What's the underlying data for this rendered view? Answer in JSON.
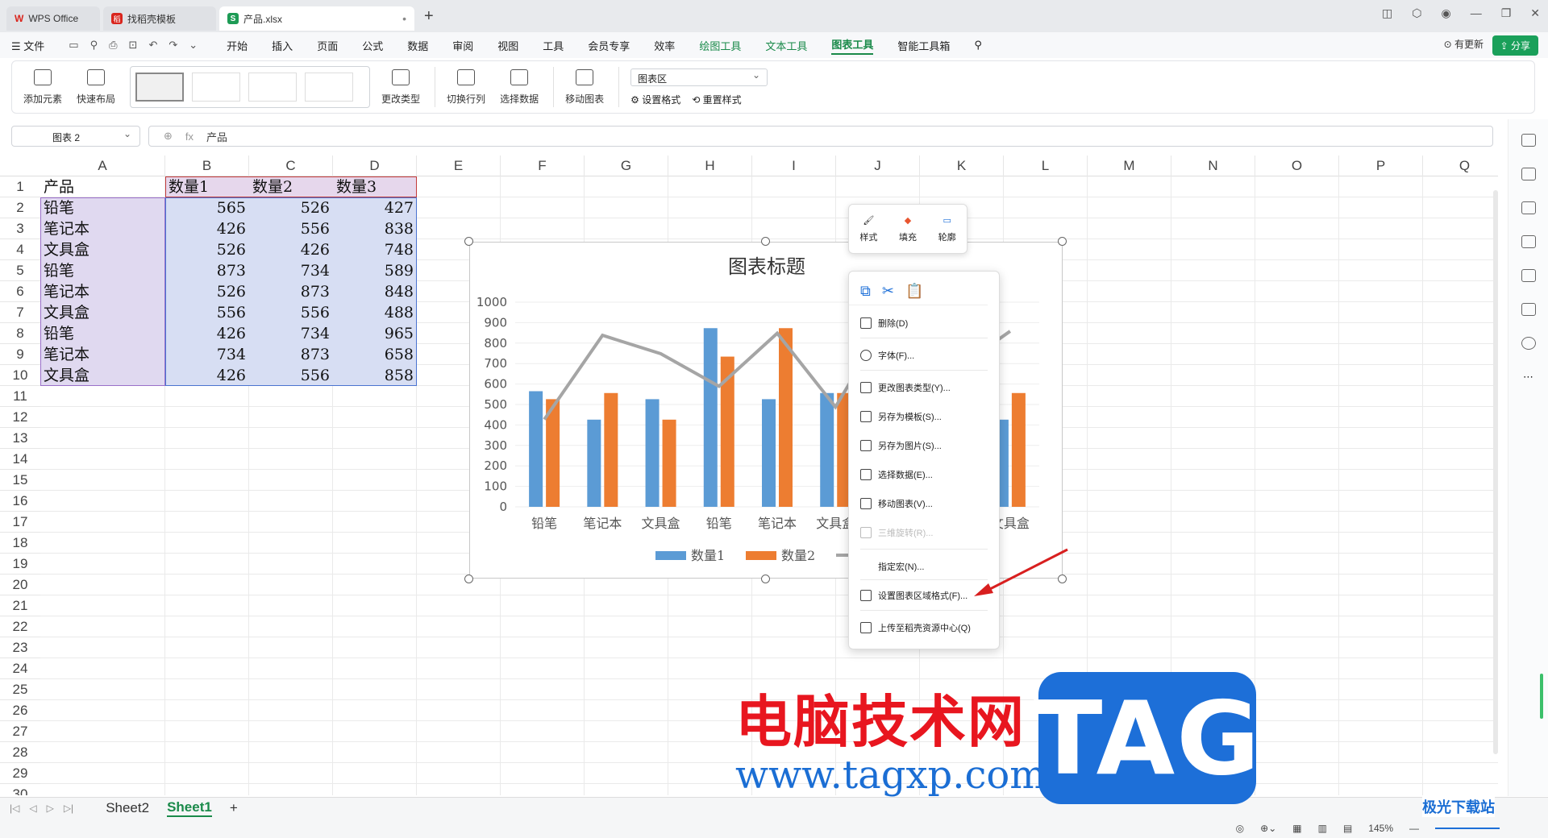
{
  "tabs": [
    {
      "label": "WPS Office"
    },
    {
      "label": "找稻壳模板"
    },
    {
      "label": "产品.xlsx"
    }
  ],
  "menu": {
    "file": "文件",
    "items": [
      "开始",
      "插入",
      "页面",
      "公式",
      "数据",
      "审阅",
      "视图",
      "工具",
      "会员专享",
      "效率",
      "绘图工具",
      "文本工具",
      "图表工具",
      "智能工具箱"
    ],
    "update": "有更新",
    "share": "分享"
  },
  "ribbon": {
    "add_element": "添加元素",
    "quick_layout": "快速布局",
    "change_type": "更改类型",
    "switch_rowcol": "切换行列",
    "select_data": "选择数据",
    "move_chart": "移动图表",
    "chart_area": "图表区",
    "set_format": "设置格式",
    "reset_style": "重置样式"
  },
  "formula": {
    "namebox": "图表 2",
    "fx": "fx",
    "value": "产品"
  },
  "columns": [
    "A",
    "B",
    "C",
    "D",
    "E",
    "F",
    "G",
    "H",
    "I",
    "J",
    "K",
    "L",
    "M",
    "N",
    "O",
    "P",
    "Q"
  ],
  "rows": [
    "1",
    "2",
    "3",
    "4",
    "5",
    "6",
    "7",
    "8",
    "9",
    "10",
    "11",
    "12",
    "13",
    "14",
    "15",
    "16",
    "17",
    "18",
    "19",
    "20",
    "21",
    "22",
    "23",
    "24",
    "25",
    "26",
    "27",
    "28",
    "29",
    "30"
  ],
  "table": {
    "header": [
      "产品",
      "数量1",
      "数量2",
      "数量3"
    ],
    "data": [
      [
        "铅笔",
        "565",
        "526",
        "427"
      ],
      [
        "笔记本",
        "426",
        "556",
        "838"
      ],
      [
        "文具盒",
        "526",
        "426",
        "748"
      ],
      [
        "铅笔",
        "873",
        "734",
        "589"
      ],
      [
        "笔记本",
        "526",
        "873",
        "848"
      ],
      [
        "文具盒",
        "556",
        "556",
        "488"
      ],
      [
        "铅笔",
        "426",
        "734",
        "965"
      ],
      [
        "笔记本",
        "734",
        "873",
        "658"
      ],
      [
        "文具盒",
        "426",
        "556",
        "858"
      ]
    ]
  },
  "chart_data": {
    "type": "bar",
    "title": "图表标题",
    "categories": [
      "铅笔",
      "笔记本",
      "文具盒",
      "铅笔",
      "笔记本",
      "文具盒",
      "铅笔",
      "笔记本",
      "文具盒"
    ],
    "series": [
      {
        "name": "数量1",
        "type": "bar",
        "color": "#5b9bd5",
        "values": [
          565,
          426,
          526,
          873,
          526,
          556,
          426,
          734,
          426
        ]
      },
      {
        "name": "数量2",
        "type": "bar",
        "color": "#ed7d31",
        "values": [
          526,
          556,
          426,
          734,
          873,
          556,
          734,
          873,
          556
        ]
      },
      {
        "name": "数量3",
        "type": "line",
        "color": "#a5a5a5",
        "values": [
          427,
          838,
          748,
          589,
          848,
          488,
          965,
          658,
          858
        ]
      }
    ],
    "ylim": [
      0,
      1000
    ],
    "yticks": [
      "0",
      "100",
      "200",
      "300",
      "400",
      "500",
      "600",
      "700",
      "800",
      "900",
      "1000"
    ],
    "legend": "bottom"
  },
  "mini_toolbar": {
    "style": "样式",
    "fill": "填充",
    "outline": "轮廓"
  },
  "context_menu": {
    "items": [
      "删除(D)",
      "字体(F)...",
      "更改图表类型(Y)...",
      "另存为模板(S)...",
      "另存为图片(S)...",
      "选择数据(E)...",
      "移动图表(V)...",
      "三维旋转(R)...",
      "指定宏(N)...",
      "设置图表区域格式(F)...",
      "上传至稻壳资源中心(Q)"
    ]
  },
  "sheets": [
    "Sheet2",
    "Sheet1"
  ],
  "status": {
    "zoom": "145%"
  },
  "watermark": {
    "cn": "电脑技术网",
    "url": "www.tagxp.com",
    "tag": "TAG",
    "corner": "极光下载站"
  }
}
